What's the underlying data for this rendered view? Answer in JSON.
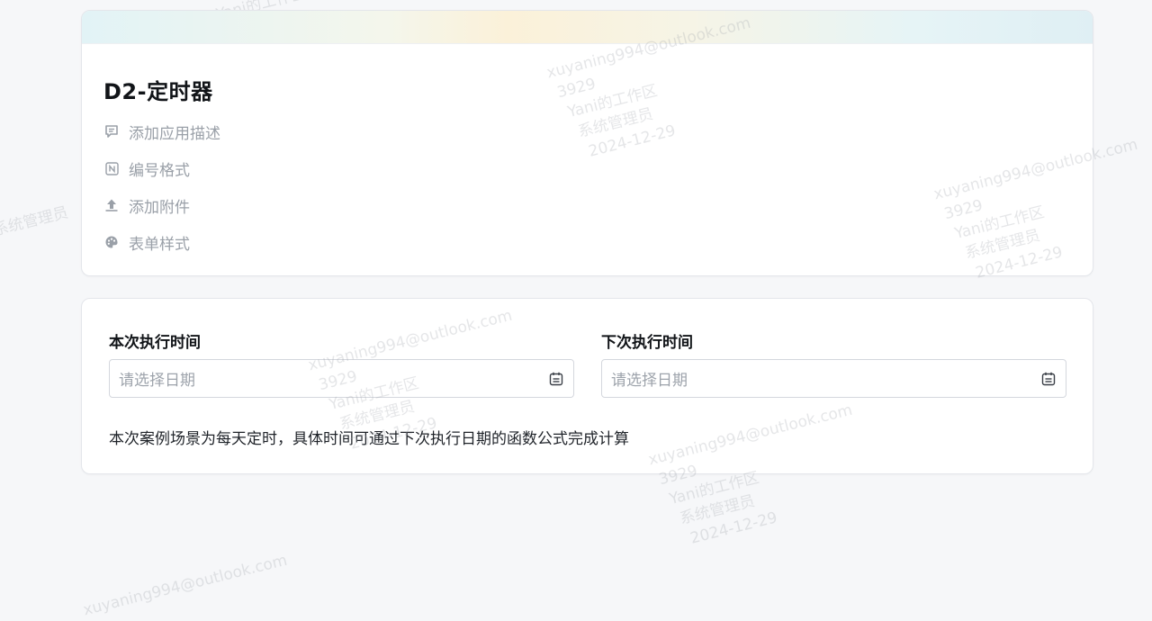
{
  "app": {
    "title": "D2-定时器",
    "menu": [
      {
        "label": "添加应用描述",
        "icon": "comment-icon"
      },
      {
        "label": "编号格式",
        "icon": "numbering-icon"
      },
      {
        "label": "添加附件",
        "icon": "upload-icon"
      },
      {
        "label": "表单样式",
        "icon": "palette-icon"
      }
    ]
  },
  "form": {
    "current_exec": {
      "label": "本次执行时间",
      "placeholder": "请选择日期"
    },
    "next_exec": {
      "label": "下次执行时间",
      "placeholder": "请选择日期"
    },
    "description": "本次案例场景为每天定时，具体时间可通过下次执行日期的函数公式完成计算"
  },
  "watermark": {
    "email": "xuyaning994@outlook.com",
    "id": "3929",
    "workspace": "Yani的工作区",
    "role": "系统管理员",
    "date": "2024-12-29"
  },
  "colors": {
    "accent_banner": "#fbf1d9",
    "background": "#f6f7f9"
  }
}
